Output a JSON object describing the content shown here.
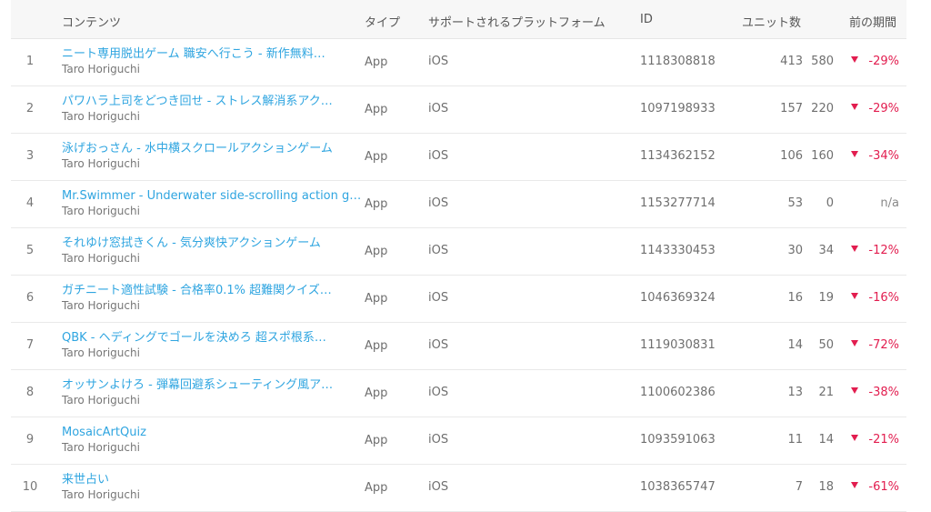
{
  "header": {
    "content": "コンテンツ",
    "type": "タイプ",
    "platform": "サポートされるプラットフォーム",
    "id": "ID",
    "units": "ユニット数",
    "prev": "前の期間"
  },
  "colors": {
    "link": "#2fa5e0",
    "decline": "#e21d4f"
  },
  "rows": [
    {
      "rank": "1",
      "title": "ニート専用脱出ゲーム 職安へ行こう - 新作無料…",
      "developer": "Taro Horiguchi",
      "type": "App",
      "platform": "iOS",
      "id": "1118308818",
      "units": "413",
      "prev": "580",
      "change": "-29%",
      "trend": "down"
    },
    {
      "rank": "2",
      "title": "パワハラ上司をどつき回せ - ストレス解消系アク…",
      "developer": "Taro Horiguchi",
      "type": "App",
      "platform": "iOS",
      "id": "1097198933",
      "units": "157",
      "prev": "220",
      "change": "-29%",
      "trend": "down"
    },
    {
      "rank": "3",
      "title": "泳げおっさん - 水中横スクロールアクションゲーム",
      "developer": "Taro Horiguchi",
      "type": "App",
      "platform": "iOS",
      "id": "1134362152",
      "units": "106",
      "prev": "160",
      "change": "-34%",
      "trend": "down"
    },
    {
      "rank": "4",
      "title": "Mr.Swimmer - Underwater side-scrolling action game",
      "developer": "Taro Horiguchi",
      "type": "App",
      "platform": "iOS",
      "id": "1153277714",
      "units": "53",
      "prev": "0",
      "change": "n/a",
      "trend": "none"
    },
    {
      "rank": "5",
      "title": "それゆけ窓拭きくん - 気分爽快アクションゲーム",
      "developer": "Taro Horiguchi",
      "type": "App",
      "platform": "iOS",
      "id": "1143330453",
      "units": "30",
      "prev": "34",
      "change": "-12%",
      "trend": "down"
    },
    {
      "rank": "6",
      "title": "ガチニート適性試験 - 合格率0.1% 超難関クイズ…",
      "developer": "Taro Horiguchi",
      "type": "App",
      "platform": "iOS",
      "id": "1046369324",
      "units": "16",
      "prev": "19",
      "change": "-16%",
      "trend": "down"
    },
    {
      "rank": "7",
      "title": "QBK - ヘディングでゴールを決めろ 超スポ根系…",
      "developer": "Taro Horiguchi",
      "type": "App",
      "platform": "iOS",
      "id": "1119030831",
      "units": "14",
      "prev": "50",
      "change": "-72%",
      "trend": "down"
    },
    {
      "rank": "8",
      "title": "オッサンよけろ - 弾幕回避系シューティング風ア…",
      "developer": "Taro Horiguchi",
      "type": "App",
      "platform": "iOS",
      "id": "1100602386",
      "units": "13",
      "prev": "21",
      "change": "-38%",
      "trend": "down"
    },
    {
      "rank": "9",
      "title": "MosaicArtQuiz",
      "developer": "Taro Horiguchi",
      "type": "App",
      "platform": "iOS",
      "id": "1093591063",
      "units": "11",
      "prev": "14",
      "change": "-21%",
      "trend": "down"
    },
    {
      "rank": "10",
      "title": "来世占い",
      "developer": "Taro Horiguchi",
      "type": "App",
      "platform": "iOS",
      "id": "1038365747",
      "units": "7",
      "prev": "18",
      "change": "-61%",
      "trend": "down"
    }
  ]
}
